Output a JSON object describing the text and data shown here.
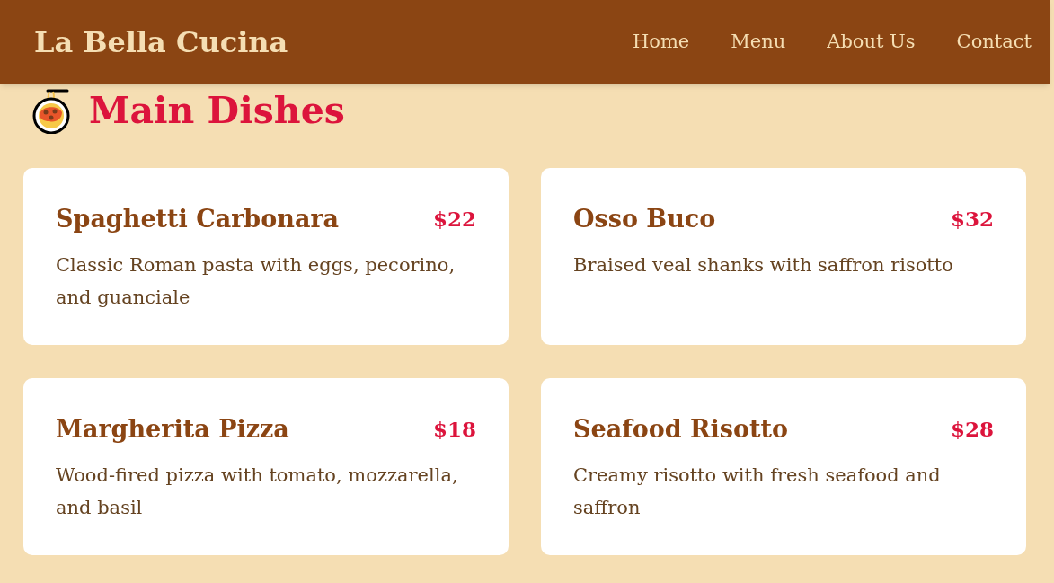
{
  "header": {
    "brand": "La Bella Cucina",
    "nav": [
      "Home",
      "Menu",
      "About Us",
      "Contact"
    ]
  },
  "section": {
    "title": "Main Dishes",
    "dishes": [
      {
        "name": "Spaghetti Carbonara",
        "price": "$22",
        "description": "Classic Roman pasta with eggs, pecorino, and guanciale"
      },
      {
        "name": "Osso Buco",
        "price": "$32",
        "description": "Braised veal shanks with saffron risotto"
      },
      {
        "name": "Margherita Pizza",
        "price": "$18",
        "description": "Wood-fired pizza with tomato, mozzarella, and basil"
      },
      {
        "name": "Seafood Risotto",
        "price": "$28",
        "description": "Creamy risotto with fresh seafood and saffron"
      }
    ]
  }
}
